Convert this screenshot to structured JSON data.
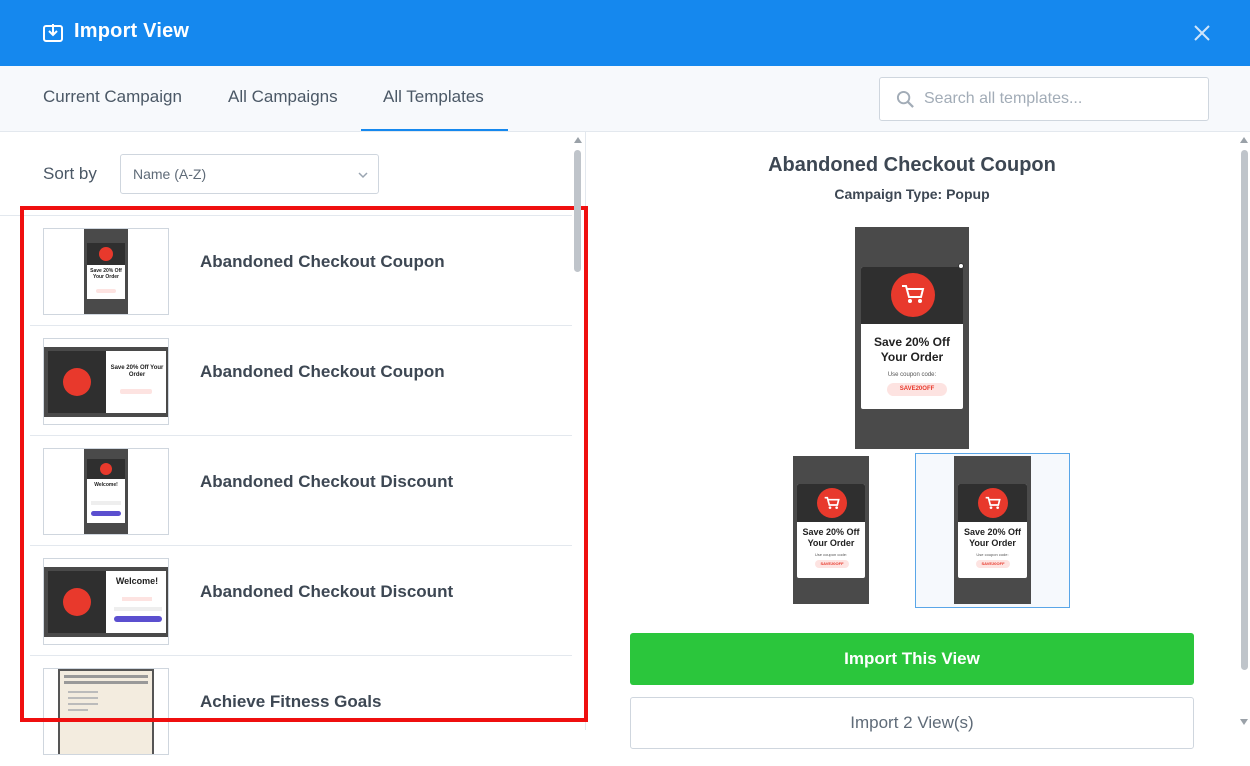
{
  "header": {
    "title": "Import View",
    "title_icon": "import-icon",
    "close_icon": "close-icon"
  },
  "tabs": [
    {
      "label": "Current Campaign",
      "active": false
    },
    {
      "label": "All Campaigns",
      "active": false
    },
    {
      "label": "All Templates",
      "active": true
    }
  ],
  "search": {
    "placeholder": "Search all templates...",
    "value": ""
  },
  "sort": {
    "label": "Sort by",
    "value": "Name (A-Z)"
  },
  "templates": [
    {
      "name": "Abandoned Checkout Coupon",
      "thumb": "popup-vertical"
    },
    {
      "name": "Abandoned Checkout Coupon",
      "thumb": "popup-horizontal"
    },
    {
      "name": "Abandoned Checkout Discount",
      "thumb": "welcome-vertical"
    },
    {
      "name": "Abandoned Checkout Discount",
      "thumb": "welcome-horizontal"
    },
    {
      "name": "Achieve Fitness Goals",
      "thumb": "text-document"
    }
  ],
  "preview": {
    "title": "Abandoned Checkout Coupon",
    "campaign_type": "Campaign Type: Popup",
    "popup_heading": "Save 20% Off Your Order",
    "popup_subtext": "Use coupon code:",
    "popup_code": "SAVE20OFF",
    "popup_subtext_alt": "Use coupon code:"
  },
  "buttons": {
    "import_this": "Import This View",
    "import_all": "Import 2 View(s)"
  },
  "colors": {
    "header_bg": "#1588ee",
    "accent": "#1588ee",
    "primary_button": "#2bc63c",
    "highlight_box": "#ef0f0f",
    "popup_circle": "#e8392c"
  }
}
